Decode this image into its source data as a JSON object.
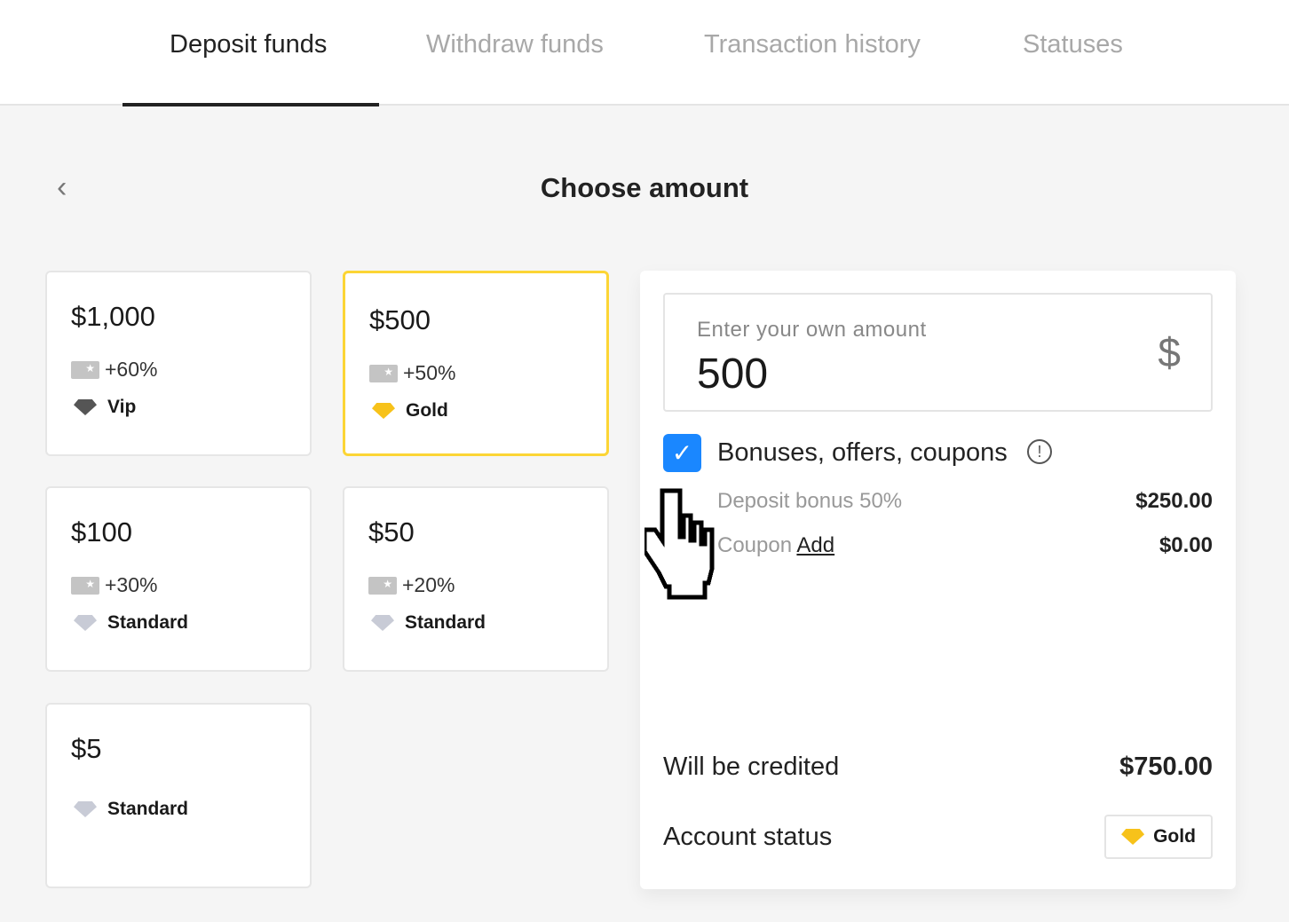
{
  "tabs": [
    {
      "label": "Deposit funds",
      "active": true
    },
    {
      "label": "Withdraw funds"
    },
    {
      "label": "Transaction history"
    },
    {
      "label": "Statuses"
    }
  ],
  "title": "Choose amount",
  "back_icon": "chevron-left-icon",
  "cards": [
    {
      "amount": "$1,000",
      "bonus": "+60%",
      "status": "Vip"
    },
    {
      "amount": "$500",
      "bonus": "+50%",
      "status": "Gold",
      "selected": true
    },
    {
      "amount": "$100",
      "bonus": "+30%",
      "status": "Standard"
    },
    {
      "amount": "$50",
      "bonus": "+20%",
      "status": "Standard"
    },
    {
      "amount": "$5",
      "status": "Standard"
    }
  ],
  "panel": {
    "input_label": "Enter your own amount",
    "input_value": "500",
    "currency": "$",
    "bonuses_label": "Bonuses, offers, coupons",
    "bonuses_checked": true,
    "deposit_bonus_label": "Deposit bonus 50%",
    "deposit_bonus_value": "$250.00",
    "coupon_label": "Coupon",
    "coupon_link": "Add",
    "coupon_value": "$0.00",
    "credited_label": "Will be credited",
    "credited_value": "$750.00",
    "status_label": "Account status",
    "status_value": "Gold"
  },
  "colors": {
    "accent": "#fcd535",
    "checkbox": "#1a87ff"
  }
}
